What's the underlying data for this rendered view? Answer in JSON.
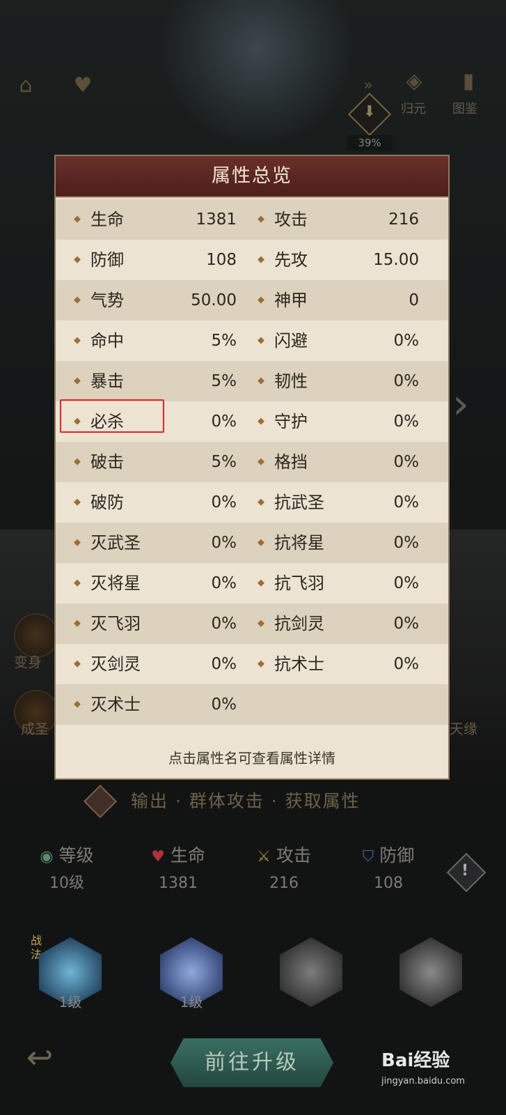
{
  "hud": {
    "progress_value": "39%",
    "guiyuan_label": "归元",
    "tujian_label": "图鉴"
  },
  "side": {
    "bianshen_label": "变身",
    "chengsheng_label": "成圣",
    "tianyuan_label": "天缘"
  },
  "modal": {
    "title": "属性总览",
    "footer_hint": "点击属性名可查看属性详情",
    "rows": [
      {
        "left_name": "生命",
        "left_value": "1381",
        "right_name": "攻击",
        "right_value": "216"
      },
      {
        "left_name": "防御",
        "left_value": "108",
        "right_name": "先攻",
        "right_value": "15.00"
      },
      {
        "left_name": "气势",
        "left_value": "50.00",
        "right_name": "神甲",
        "right_value": "0"
      },
      {
        "left_name": "命中",
        "left_value": "5%",
        "right_name": "闪避",
        "right_value": "0%"
      },
      {
        "left_name": "暴击",
        "left_value": "5%",
        "right_name": "韧性",
        "right_value": "0%"
      },
      {
        "left_name": "必杀",
        "left_value": "0%",
        "right_name": "守护",
        "right_value": "0%"
      },
      {
        "left_name": "破击",
        "left_value": "5%",
        "right_name": "格挡",
        "right_value": "0%"
      },
      {
        "left_name": "破防",
        "left_value": "0%",
        "right_name": "抗武圣",
        "right_value": "0%"
      },
      {
        "left_name": "灭武圣",
        "left_value": "0%",
        "right_name": "抗将星",
        "right_value": "0%"
      },
      {
        "left_name": "灭将星",
        "left_value": "0%",
        "right_name": "抗飞羽",
        "right_value": "0%"
      },
      {
        "left_name": "灭飞羽",
        "left_value": "0%",
        "right_name": "抗剑灵",
        "right_value": "0%"
      },
      {
        "left_name": "灭剑灵",
        "left_value": "0%",
        "right_name": "抗术士",
        "right_value": "0%"
      },
      {
        "left_name": "灭术士",
        "left_value": "0%",
        "right_name": "",
        "right_value": ""
      }
    ]
  },
  "hero": {
    "tags": "输出 · 群体攻击 · 获取属性",
    "stats": [
      {
        "label": "等级",
        "value": "10级",
        "icon": "level-icon"
      },
      {
        "label": "生命",
        "value": "1381",
        "icon": "heart-icon"
      },
      {
        "label": "攻击",
        "value": "216",
        "icon": "swords-icon"
      },
      {
        "label": "防御",
        "value": "108",
        "icon": "shield-icon"
      }
    ],
    "skill_tag": "战法",
    "skills": [
      {
        "level": "1级"
      },
      {
        "level": "1级"
      },
      {
        "level": ""
      },
      {
        "level": ""
      }
    ],
    "upgrade_label": "前往升级"
  },
  "watermark": {
    "text": "Bai经验",
    "sub": "jingyan.baidu.com"
  },
  "colors": {
    "modal_header": "#5a2623",
    "modal_body": "#ece3d2",
    "bullet": "#9a6f37",
    "highlight": "#e0232a"
  }
}
